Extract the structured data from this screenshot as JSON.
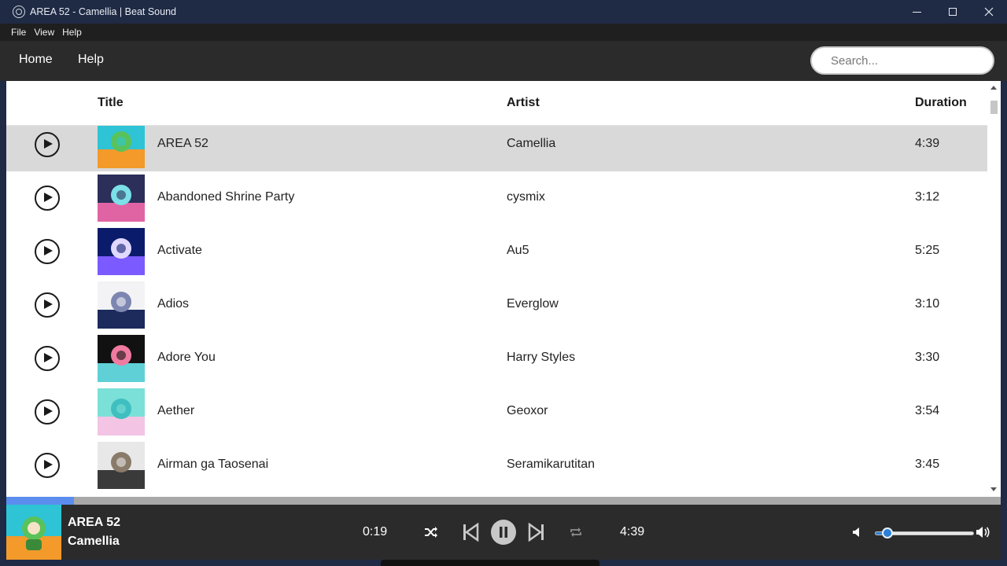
{
  "window": {
    "title": "AREA 52 - Camellia | Beat Sound"
  },
  "menu": {
    "items": [
      "File",
      "View",
      "Help"
    ]
  },
  "header": {
    "nav": [
      "Home",
      "Help"
    ],
    "search_placeholder": "Search..."
  },
  "table": {
    "columns": {
      "title": "Title",
      "artist": "Artist",
      "duration": "Duration"
    },
    "rows": [
      {
        "title": "",
        "artist": "",
        "duration": "",
        "cover_colors": [
          "#ff4aa8",
          "#3f5fff",
          "#ffcc33"
        ]
      },
      {
        "title": "AREA 52",
        "artist": "Camellia",
        "duration": "4:39",
        "selected": true,
        "cover_colors": [
          "#2ec4d6",
          "#f39a2b",
          "#59c25a"
        ]
      },
      {
        "title": "Abandoned Shrine Party",
        "artist": "cysmix",
        "duration": "3:12",
        "cover_colors": [
          "#2b2f5a",
          "#e064a4",
          "#7ce0e8"
        ]
      },
      {
        "title": "Activate",
        "artist": "Au5",
        "duration": "5:25",
        "cover_colors": [
          "#0b1b6b",
          "#7b5bff",
          "#e0d8ff"
        ]
      },
      {
        "title": "Adios",
        "artist": "Everglow",
        "duration": "3:10",
        "cover_colors": [
          "#f3f3f5",
          "#1c2a5c",
          "#7c86b0"
        ]
      },
      {
        "title": "Adore You",
        "artist": "Harry Styles",
        "duration": "3:30",
        "cover_colors": [
          "#111111",
          "#5fd0d6",
          "#f07aa0"
        ]
      },
      {
        "title": "Aether",
        "artist": "Geoxor",
        "duration": "3:54",
        "cover_colors": [
          "#7be0d8",
          "#f3c4e4",
          "#3fbfbf"
        ]
      },
      {
        "title": "Airman ga Taosenai",
        "artist": "Seramikarutitan",
        "duration": "3:45",
        "cover_colors": [
          "#e8e8e8",
          "#3a3a3a",
          "#8a7a6a"
        ]
      }
    ]
  },
  "player": {
    "now_playing_title": "AREA 52",
    "now_playing_artist": "Camellia",
    "elapsed": "0:19",
    "total": "4:39",
    "progress_fraction": 0.068,
    "volume_fraction": 0.12,
    "icons": [
      "shuffle-icon",
      "previous-icon",
      "pause-icon",
      "next-icon",
      "repeat-icon",
      "volume-low-icon",
      "volume-high-icon"
    ]
  },
  "colors": {
    "titlebar": "#1f2a44",
    "header": "#2b2b2b",
    "selected_row": "#d9d9d9",
    "accent": "#5b8def",
    "volume": "#2a7fd6"
  }
}
